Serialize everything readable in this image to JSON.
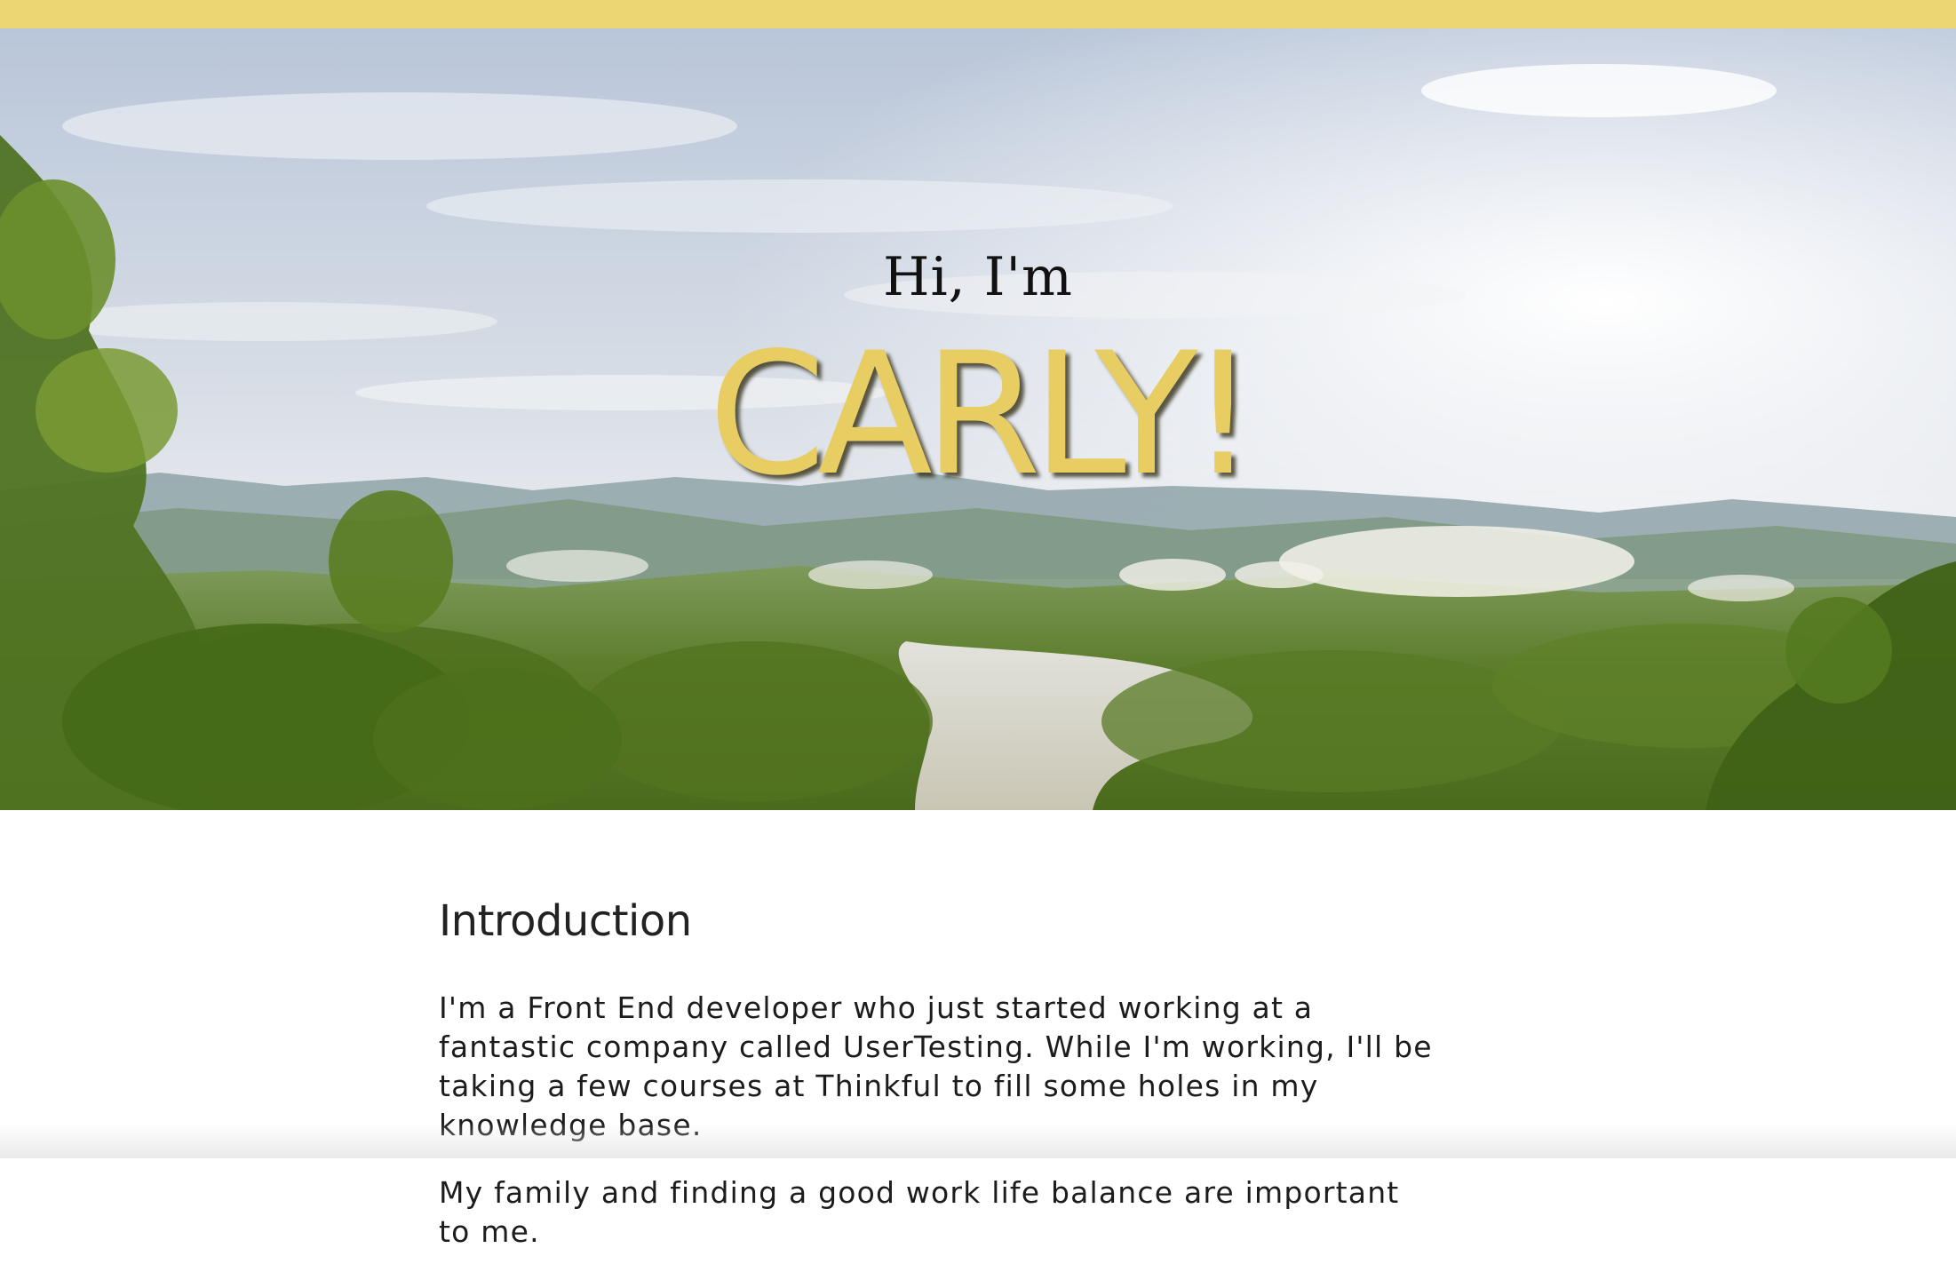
{
  "colors": {
    "accent": "#ecd673",
    "name_yellow": "#e8cd62",
    "text": "#1c1c1c"
  },
  "hero": {
    "greeting": "Hi, I'm",
    "name": "CARLY!"
  },
  "intro": {
    "heading": "Introduction",
    "paragraphs": [
      "I'm a Front End developer who just started working at a fantastic company called UserTesting. While I'm working, I'll be taking a few courses at Thinkful to fill some holes in my knowledge base.",
      "My family and finding a good work life balance are important to me."
    ]
  }
}
